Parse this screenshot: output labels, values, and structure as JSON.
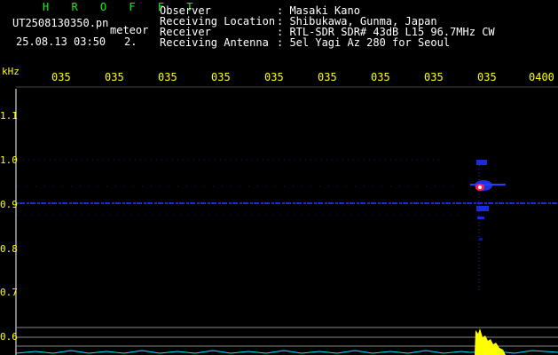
{
  "header": {
    "title": "H R O F F T",
    "filename": "UT2508130350.pn",
    "mode": "meteor",
    "datetime": "25.08.13 03:50",
    "count": "2.",
    "info": [
      {
        "label": "Observer",
        "value": ": Masaki Kano"
      },
      {
        "label": "Receiving Location",
        "value": ": Shibukawa, Gunma, Japan"
      },
      {
        "label": "Receiver",
        "value": ": RTL-SDR SDR# 43dB L15 96.7MHz CW"
      },
      {
        "label": "Receiving Antenna",
        "value": ": 5el Yagi Az 280 for Seoul"
      }
    ]
  },
  "spectrogram": {
    "y_unit": "kHz",
    "y_ticks": [
      "1.1",
      "1.0",
      "0.9",
      "0.8",
      "0.7",
      "0.6"
    ],
    "x_ticks": [
      "035",
      "035",
      "035",
      "035",
      "035",
      "035",
      "035",
      "035",
      "035",
      "0400"
    ],
    "colors": {
      "text": "#ffff00",
      "header_label": "#00ff00",
      "carrier": "#1a2bd8",
      "echo": "#ff2050",
      "power_trace": "#00e5ff",
      "meteor_power": "#ffff00"
    }
  }
}
